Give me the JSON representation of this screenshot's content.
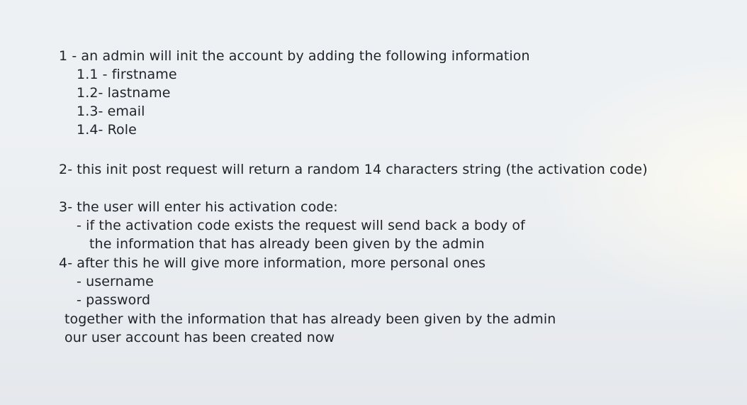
{
  "notes": {
    "lines": [
      "1 - an admin will init the account by adding the following information",
      "1.1 - firstname",
      "1.2- lastname",
      "1.3- email",
      "1.4- Role",
      "2- this init post request will return a random 14 characters string (the activation code)",
      "3- the user will enter his activation code:",
      "- if the activation code exists the request will send back a body of",
      "the information that has already been given by the admin",
      "4- after this he will give more information, more personal ones",
      "- username",
      "- password",
      "together with the information that has already been given by the admin",
      "our user account has been created now"
    ]
  }
}
